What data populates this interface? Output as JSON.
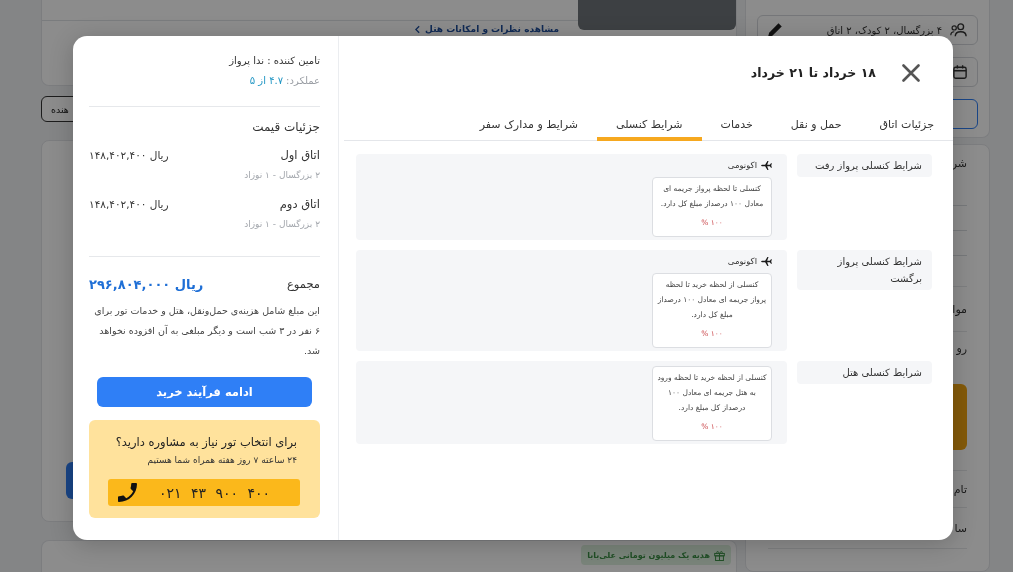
{
  "background": {
    "hotel_card": {
      "reviews_link": "مشاهده نظرات و امکانات هتل"
    },
    "filter_button": "هنده",
    "offer_badge": "هدیه یک میلیون تومانی علی‌بابا",
    "search_card": {
      "guests": "۴ بزرگسال، ۲ کودک، ۲ اتاق"
    },
    "details_card": {
      "sections": [
        "شر",
        "موا",
        "رو",
        "تام",
        "سا"
      ]
    }
  },
  "modal": {
    "title": "۱۸ خرداد تا ۲۱ خرداد",
    "tabs": [
      {
        "label": "جزئیات اتاق",
        "selected": false
      },
      {
        "label": "حمل و نقل",
        "selected": false
      },
      {
        "label": "خدمات",
        "selected": false
      },
      {
        "label": "شرایط کنسلی",
        "selected": true
      },
      {
        "label": "شرایط و مدارک سفر",
        "selected": false
      }
    ],
    "cancellation_rules": [
      {
        "title": "شرایط کنسلی پرواز رفت",
        "fare_class": "اکونومی",
        "rule": "کنسلی تا لحظه پرواز جریمه ای معادل ۱۰۰ درصداز مبلغ کل دارد.",
        "penalty": "۱۰۰ %"
      },
      {
        "title": "شرایط کنسلی پرواز برگشت",
        "fare_class": "اکونومی",
        "rule": "کنسلی از لحظه خرید تا لحظه پرواز جریمه ای معادل ۱۰۰ درصداز مبلغ کل دارد.",
        "penalty": "۱۰۰ %"
      },
      {
        "title": "شرایط کنسلی هتل",
        "rule": "کنسلی از لحظه خرید تا لحظه ورود به هتل جریمه ای معادل ۱۰۰ درصداز کل مبلغ دارد.",
        "penalty": "۱۰۰ %"
      }
    ],
    "summary": {
      "supplier": "تامین کننده : ندا پرواز",
      "rating_label": "عملکرد:",
      "rating_value": "۴.۷ از ۵",
      "price_heading": "جزئیات قیمت",
      "rooms": [
        {
          "name": "اتاق اول",
          "guests": "۲ بزرگسال - ۱ نوزاد",
          "price": "۱۴۸,۴۰۲,۴۰۰ ریال"
        },
        {
          "name": "اتاق دوم",
          "guests": "۲ بزرگسال - ۱ نوزاد",
          "price": "۱۴۸,۴۰۲,۴۰۰ ریال"
        }
      ],
      "total_label": "مجموع",
      "total": "۲۹۶,۸۰۴,۰۰۰ ریال",
      "note": "این مبلغ شامل هزینه‌ی حمل‌ونقل، هتل و خدمات تور برای ۶ نفر در ۳ شب است و دیگر مبلغی به آن افزوده نخواهد شد.",
      "continue_button": "ادامه فرآیند خرید",
      "help": {
        "question": "برای انتخاب تور نیاز به مشاوره دارید؟",
        "hours": "۲۴ ساعته ۷ روز هفته همراه شما هستیم",
        "phone": "۰۲۱ ۴۳ ۹۰۰ ۴۰۰"
      }
    }
  }
}
